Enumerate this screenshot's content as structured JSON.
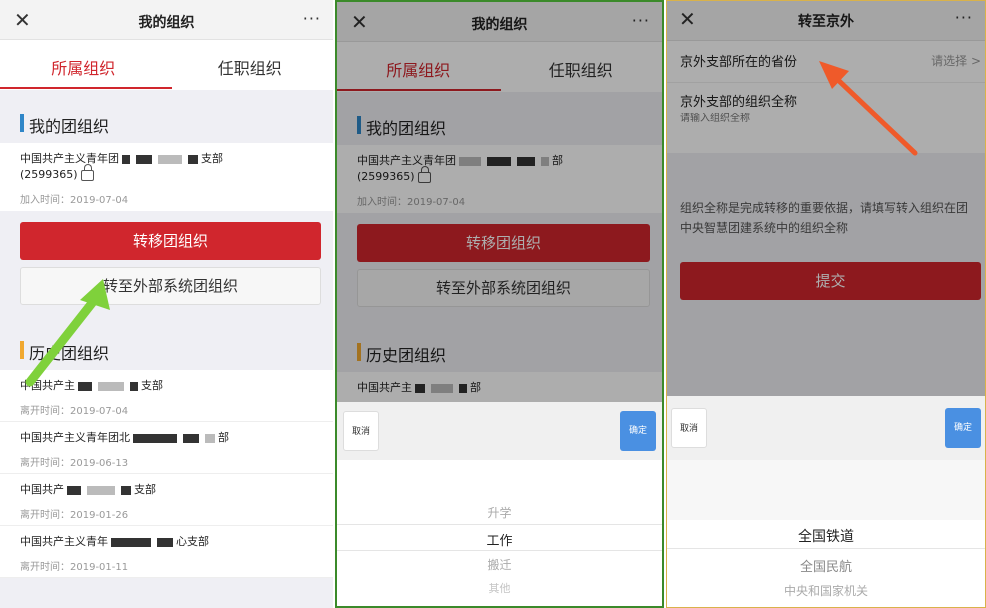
{
  "panel1": {
    "title": "我的组织",
    "close": "✕",
    "more": "···",
    "tabs": [
      "所属组织",
      "任职组织"
    ],
    "my_section": "我的团组织",
    "org_name_prefix": "中国共产主义青年团",
    "org_name_suffix": "支部",
    "org_code": "(2599365)",
    "join_time": "加入时间：2019-07-04",
    "transfer_button": "转移团组织",
    "external_button": "转至外部系统团组织",
    "history_section": "历史团组织",
    "history": [
      {
        "prefix": "中国共产主",
        "suffix": "支部",
        "time": "离开时间：2019-07-04"
      },
      {
        "prefix": "中国共产主义青年团北",
        "suffix": "部",
        "time": "离开时间：2019-06-13"
      },
      {
        "prefix": "中国共产",
        "suffix": "支部",
        "time": "离开时间：2019-01-26"
      },
      {
        "prefix": "中国共产主义青年",
        "suffix": "心支部",
        "time": "离开时间：2019-01-11"
      }
    ]
  },
  "panel2": {
    "title": "我的组织",
    "close": "✕",
    "more": "···",
    "tabs": [
      "所属组织",
      "任职组织"
    ],
    "my_section": "我的团组织",
    "org_name_prefix": "中国共产主义青年团",
    "org_name_suffix": "部",
    "org_code": "(2599365)",
    "join_time": "加入时间：2019-07-04",
    "transfer_button": "转移团组织",
    "external_button": "转至外部系统团组织",
    "history_section": "历史团组织",
    "history_prefix": "中国共产主",
    "history_suffix": "部",
    "cancel": "取消",
    "confirm": "确定",
    "options": [
      "升学",
      "工作",
      "搬迁",
      "其他"
    ],
    "selected": "工作"
  },
  "panel3": {
    "title": "转至京外",
    "close": "✕",
    "more": "···",
    "province_label": "京外支部所在的省份",
    "province_placeholder": "请选择 >",
    "fullname_label": "京外支部的组织全称",
    "fullname_placeholder": "请输入组织全称",
    "hint": "组织全称是完成转移的重要依据，请填写转入组织在团中央智慧团建系统中的组织全称",
    "submit": "提交",
    "cancel": "取消",
    "confirm": "确定",
    "options": [
      "全国铁道",
      "全国民航",
      "中央和国家机关"
    ],
    "selected": "全国铁道"
  },
  "colors": {
    "primary_red": "#d0262d",
    "confirm_blue": "#4a90e2",
    "arrow_green": "#7fd13b",
    "arrow_orange": "#ef5a2a"
  }
}
